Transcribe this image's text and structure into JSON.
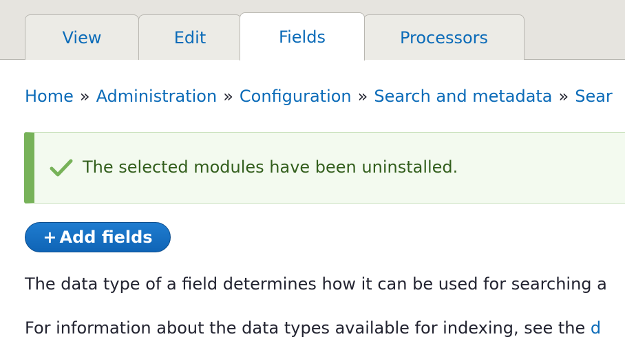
{
  "tabs": {
    "view": "View",
    "edit": "Edit",
    "fields": "Fields",
    "processors": "Processors"
  },
  "breadcrumb": {
    "items": [
      "Home",
      "Administration",
      "Configuration",
      "Search and metadata",
      "Sear"
    ],
    "separator": "»"
  },
  "message": {
    "text": "The selected modules have been uninstalled.",
    "icon": "checkmark-icon"
  },
  "add_fields_button": {
    "plus": "+",
    "label": "Add fields"
  },
  "paragraphs": {
    "p1": "The data type of a field determines how it can be used for searching a",
    "p2": "For information about the data types available for indexing, see the ",
    "p2_link": "d"
  },
  "colors": {
    "link": "#0b6bb8",
    "success_border": "#77b259",
    "success_text": "#325e1c",
    "button": "#0f64b6"
  }
}
